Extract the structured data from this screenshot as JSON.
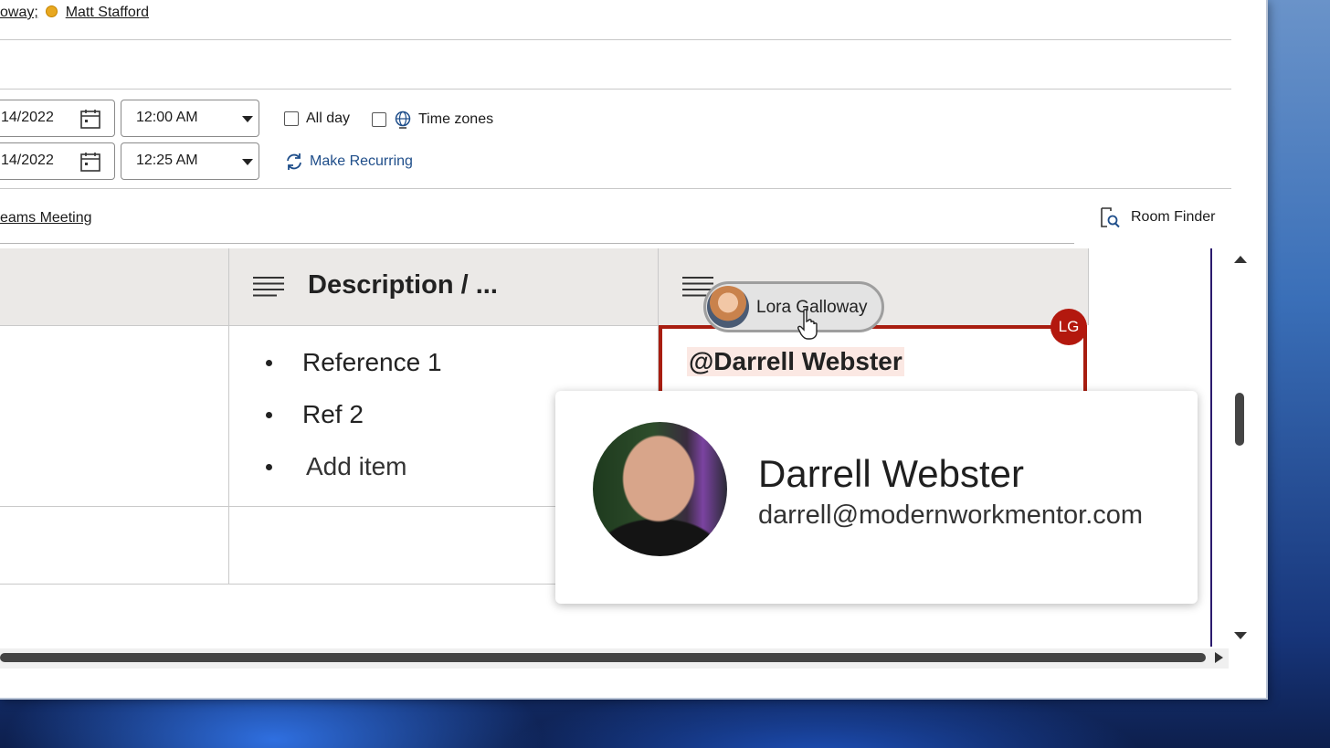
{
  "attendees": {
    "partial_name": "oway;",
    "name": "Matt Stafford"
  },
  "start": {
    "date": "14/2022",
    "time": "12:00 AM"
  },
  "end": {
    "date": "14/2022",
    "time": "12:25 AM"
  },
  "options": {
    "all_day_label": "All day",
    "time_zones_label": "Time zones",
    "make_recurring_label": "Make Recurring"
  },
  "location": {
    "teams_label": "eams Meeting",
    "room_finder_label": "Room Finder"
  },
  "table": {
    "columns": [
      {
        "title": ""
      },
      {
        "title": "Description / ..."
      },
      {
        "title": ""
      }
    ],
    "description_items": [
      "Reference 1",
      "Ref 2",
      "Add item"
    ],
    "comment_mention": "@Darrell Webster"
  },
  "coauthor": {
    "name": "Lora Galloway",
    "initials": "LG",
    "color": "#b3180e"
  },
  "contact_card": {
    "name": "Darrell Webster",
    "email": "darrell@modernworkmentor.com"
  },
  "icons": [
    "calendar-icon",
    "globe-icon",
    "recurring-icon",
    "room-finder-icon",
    "lines-icon",
    "hand-cursor-icon"
  ]
}
